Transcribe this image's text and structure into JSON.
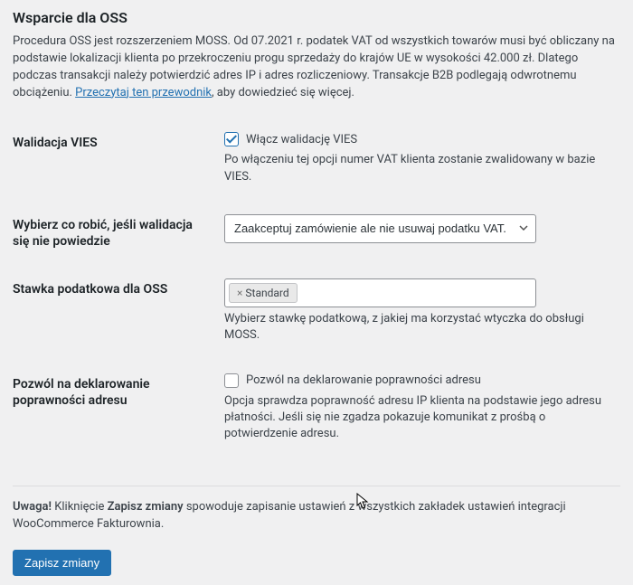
{
  "heading": "Wsparcie dla OSS",
  "intro": {
    "part1": "Procedura OSS jest rozszerzeniem MOSS. Od 07.2021 r. podatek VAT od wszystkich towarów musi być obliczany na podstawie lokalizacji klienta po przekroczeniu progu sprzedaży do krajów UE w wysokości 42.000 zł. Dlatego podczas transakcji należy potwierdzić adres IP i adres rozliczeniowy. Transakcje B2B podlegają odwrotnemu obciążeniu. ",
    "link": "Przeczytaj ten przewodnik",
    "part2": ", aby dowiedzieć się więcej."
  },
  "fields": {
    "vies": {
      "th": "Walidacja VIES",
      "checkbox_label": "Włącz walidację VIES",
      "checked": true,
      "desc": "Po włączeniu tej opcji numer VAT klienta zostanie zwalidowany w bazie VIES."
    },
    "fail_action": {
      "th": "Wybierz co robić, jeśli walidacja się nie powiedzie",
      "selected": "Zaakceptuj zamówienie ale nie usuwaj podatku VAT."
    },
    "rate": {
      "th": "Stawka podatkowa dla OSS",
      "tag": "Standard",
      "desc": "Wybierz stawkę podatkową, z jakiej ma korzystać wtyczka do obsługi MOSS."
    },
    "address_declare": {
      "th": "Pozwól na deklarowanie poprawności adresu",
      "checkbox_label": "Pozwól na deklarowanie poprawności adresu",
      "checked": false,
      "desc": "Opcja sprawdza poprawność adresu IP klienta na podstawie jego adresu płatności. Jeśli się nie zgadza pokazuje komunikat z prośbą o potwierdzenie adresu."
    }
  },
  "notice": {
    "bold1": "Uwaga!",
    "text1": " Kliknięcie ",
    "bold2": "Zapisz zmiany",
    "text2": " spowoduje zapisanie ustawień z wszystkich zakładek ustawień integracji WooCommerce Fakturownia."
  },
  "submit": "Zapisz zmiany"
}
